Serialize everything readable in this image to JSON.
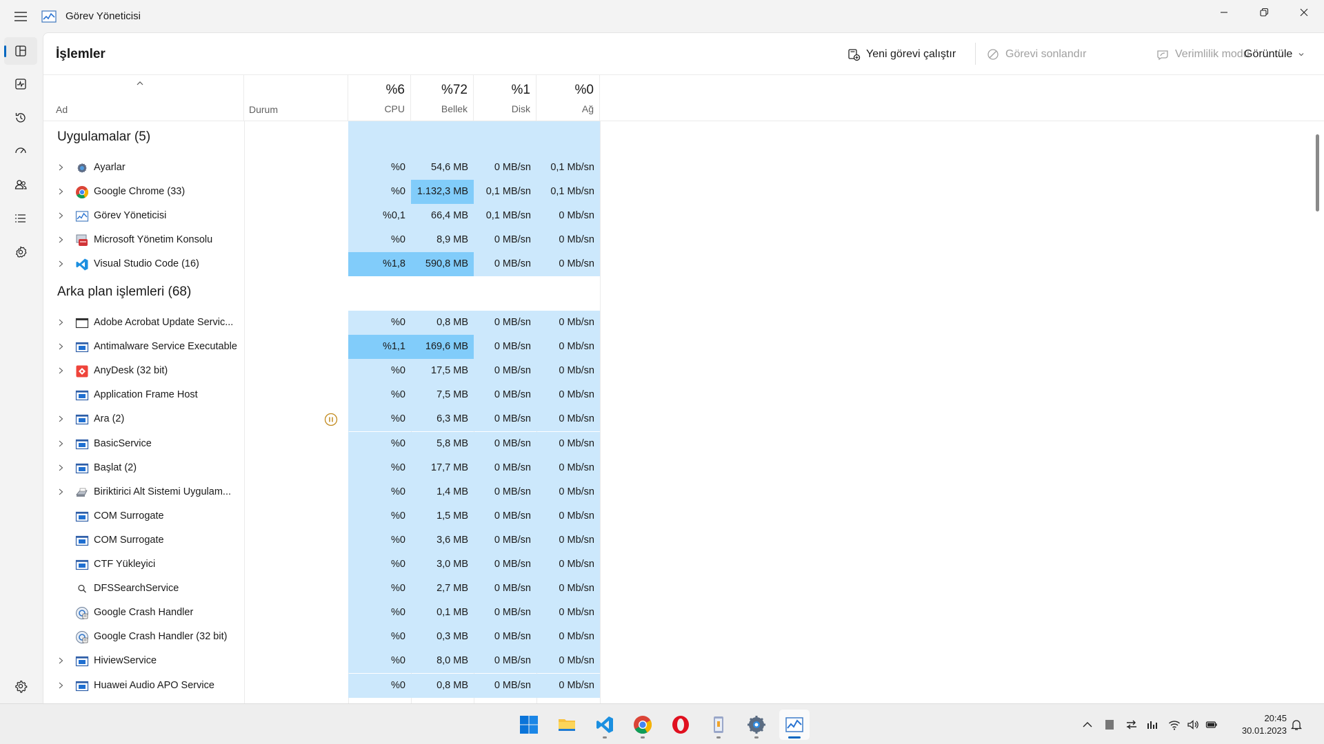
{
  "window": {
    "title": "Görev Yöneticisi"
  },
  "nav": {
    "items": [
      {
        "name": "processes",
        "icon": "processes-icon",
        "active": true
      },
      {
        "name": "performance",
        "icon": "performance-icon"
      },
      {
        "name": "app-history",
        "icon": "history-icon"
      },
      {
        "name": "startup",
        "icon": "startup-icon"
      },
      {
        "name": "users",
        "icon": "users-icon"
      },
      {
        "name": "details",
        "icon": "details-icon"
      },
      {
        "name": "services",
        "icon": "services-icon"
      }
    ],
    "settings_icon": "gear-icon"
  },
  "toolbar": {
    "title": "İşlemler",
    "run_new_task": "Yeni görevi çalıştır",
    "end_task": "Görevi sonlandır",
    "efficiency_mode": "Verimlilik modu",
    "view": "Görüntüle"
  },
  "columns": {
    "name": "Ad",
    "status": "Durum",
    "cpu_pct": "%6",
    "cpu": "CPU",
    "mem_pct": "%72",
    "mem": "Bellek",
    "disk_pct": "%1",
    "disk": "Disk",
    "net_pct": "%0",
    "net": "Ağ"
  },
  "groups": {
    "apps": "Uygulamalar (5)",
    "background": "Arka plan işlemleri (68)"
  },
  "apps": [
    {
      "name": "Ayarlar",
      "icon": "settings-app-icon",
      "expand": true,
      "cpu": "%0",
      "mem": "54,6 MB",
      "disk": "0 MB/sn",
      "net": "0,1 Mb/sn",
      "heat": [
        0,
        0,
        0,
        0
      ]
    },
    {
      "name": "Google Chrome (33)",
      "icon": "chrome-icon",
      "expand": true,
      "cpu": "%0",
      "mem": "1.132,3 MB",
      "disk": "0,1 MB/sn",
      "net": "0,1 Mb/sn",
      "heat": [
        0,
        2,
        0,
        0
      ]
    },
    {
      "name": "Görev Yöneticisi",
      "icon": "task-manager-icon",
      "expand": true,
      "cpu": "%0,1",
      "mem": "66,4 MB",
      "disk": "0,1 MB/sn",
      "net": "0 Mb/sn",
      "heat": [
        0,
        0,
        0,
        0
      ]
    },
    {
      "name": "Microsoft Yönetim Konsolu",
      "icon": "mmc-icon",
      "expand": true,
      "cpu": "%0",
      "mem": "8,9 MB",
      "disk": "0 MB/sn",
      "net": "0 Mb/sn",
      "heat": [
        0,
        0,
        0,
        0
      ]
    },
    {
      "name": "Visual Studio Code (16)",
      "icon": "vscode-icon",
      "expand": true,
      "cpu": "%1,8",
      "mem": "590,8 MB",
      "disk": "0 MB/sn",
      "net": "0 Mb/sn",
      "heat": [
        2,
        2,
        0,
        0
      ]
    }
  ],
  "background": [
    {
      "name": "Adobe Acrobat Update Servic...",
      "icon": "window-icon",
      "expand": true,
      "cpu": "%0",
      "mem": "0,8 MB",
      "disk": "0 MB/sn",
      "net": "0 Mb/sn",
      "heat": [
        0,
        0,
        0,
        0
      ]
    },
    {
      "name": "Antimalware Service Executable",
      "icon": "service-icon",
      "expand": true,
      "cpu": "%1,1",
      "mem": "169,6 MB",
      "disk": "0 MB/sn",
      "net": "0 Mb/sn",
      "heat": [
        2,
        2,
        0,
        0
      ]
    },
    {
      "name": "AnyDesk (32 bit)",
      "icon": "anydesk-icon",
      "expand": true,
      "cpu": "%0",
      "mem": "17,5 MB",
      "disk": "0 MB/sn",
      "net": "0 Mb/sn",
      "heat": [
        0,
        0,
        0,
        0
      ]
    },
    {
      "name": "Application Frame Host",
      "icon": "service-icon",
      "expand": false,
      "cpu": "%0",
      "mem": "7,5 MB",
      "disk": "0 MB/sn",
      "net": "0 Mb/sn",
      "heat": [
        0,
        0,
        0,
        0
      ]
    },
    {
      "name": "Ara (2)",
      "icon": "service-icon",
      "expand": true,
      "paused": true,
      "cpu": "%0",
      "mem": "6,3 MB",
      "disk": "0 MB/sn",
      "net": "0 Mb/sn",
      "heat": [
        0,
        0,
        0,
        0
      ]
    },
    {
      "name": "BasicService",
      "icon": "service-icon",
      "expand": true,
      "cpu": "%0",
      "mem": "5,8 MB",
      "disk": "0 MB/sn",
      "net": "0 Mb/sn",
      "heat": [
        0,
        0,
        0,
        0
      ]
    },
    {
      "name": "Başlat (2)",
      "icon": "service-icon",
      "expand": true,
      "cpu": "%0",
      "mem": "17,7 MB",
      "disk": "0 MB/sn",
      "net": "0 Mb/sn",
      "heat": [
        0,
        0,
        0,
        0
      ]
    },
    {
      "name": "Biriktirici Alt Sistemi Uygulam...",
      "icon": "printer-icon",
      "expand": true,
      "cpu": "%0",
      "mem": "1,4 MB",
      "disk": "0 MB/sn",
      "net": "0 Mb/sn",
      "heat": [
        0,
        0,
        0,
        0
      ]
    },
    {
      "name": "COM Surrogate",
      "icon": "service-icon",
      "expand": false,
      "cpu": "%0",
      "mem": "1,5 MB",
      "disk": "0 MB/sn",
      "net": "0 Mb/sn",
      "heat": [
        0,
        0,
        0,
        0
      ]
    },
    {
      "name": "COM Surrogate",
      "icon": "service-icon",
      "expand": false,
      "cpu": "%0",
      "mem": "3,6 MB",
      "disk": "0 MB/sn",
      "net": "0 Mb/sn",
      "heat": [
        0,
        0,
        0,
        0
      ]
    },
    {
      "name": "CTF Yükleyici",
      "icon": "service-icon",
      "expand": false,
      "cpu": "%0",
      "mem": "3,0 MB",
      "disk": "0 MB/sn",
      "net": "0 Mb/sn",
      "heat": [
        0,
        0,
        0,
        0
      ]
    },
    {
      "name": "DFSSearchService",
      "icon": "search-icon",
      "expand": false,
      "cpu": "%0",
      "mem": "2,7 MB",
      "disk": "0 MB/sn",
      "net": "0 Mb/sn",
      "heat": [
        0,
        0,
        0,
        0
      ]
    },
    {
      "name": "Google Crash Handler",
      "icon": "google-crash-icon",
      "expand": false,
      "cpu": "%0",
      "mem": "0,1 MB",
      "disk": "0 MB/sn",
      "net": "0 Mb/sn",
      "heat": [
        0,
        0,
        0,
        0
      ]
    },
    {
      "name": "Google Crash Handler (32 bit)",
      "icon": "google-crash-icon",
      "expand": false,
      "cpu": "%0",
      "mem": "0,3 MB",
      "disk": "0 MB/sn",
      "net": "0 Mb/sn",
      "heat": [
        0,
        0,
        0,
        0
      ]
    },
    {
      "name": "HiviewService",
      "icon": "service-icon",
      "expand": true,
      "cpu": "%0",
      "mem": "8,0 MB",
      "disk": "0 MB/sn",
      "net": "0 Mb/sn",
      "heat": [
        0,
        0,
        0,
        0
      ]
    },
    {
      "name": "Huawei Audio APO Service",
      "icon": "service-icon",
      "expand": true,
      "cpu": "%0",
      "mem": "0,8 MB",
      "disk": "0 MB/sn",
      "net": "0 Mb/sn",
      "heat": [
        0,
        0,
        0,
        0
      ]
    }
  ],
  "taskbar": {
    "apps": [
      "start-icon",
      "file-explorer-icon",
      "vscode-icon",
      "chrome-icon",
      "opera-icon",
      "notepad-icon",
      "settings-icon",
      "task-manager-icon"
    ],
    "time": "20:45",
    "date": "30.01.2023"
  },
  "colors": {
    "accent": "#0067c0",
    "heat_low": "#cce8fc",
    "heat_mid": "#a8d9fb",
    "heat_high": "#81ccfa"
  }
}
